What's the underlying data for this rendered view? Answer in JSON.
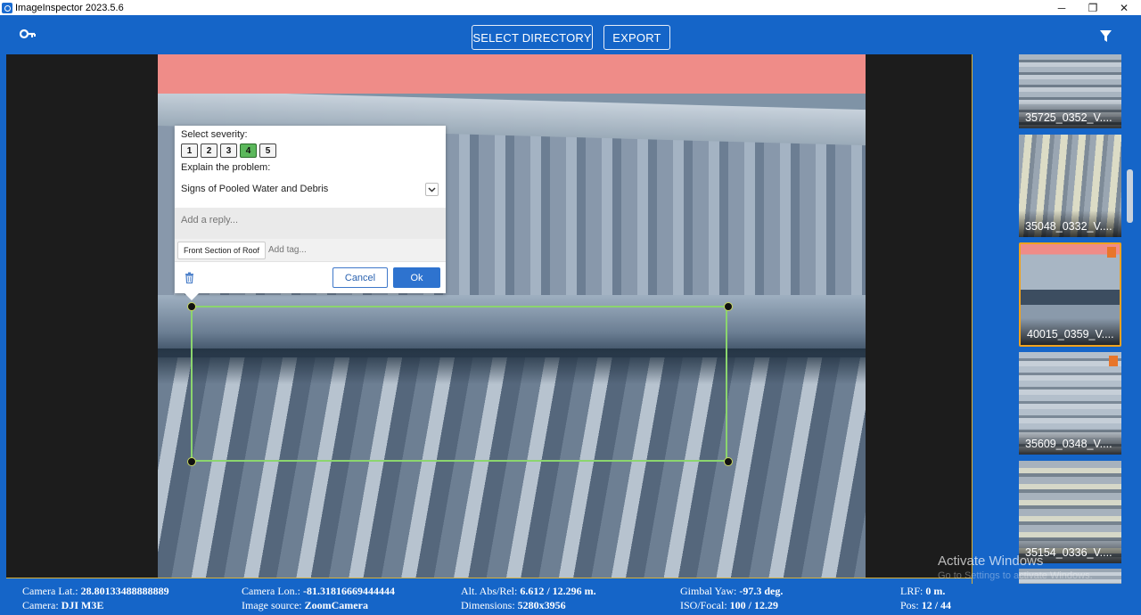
{
  "window": {
    "title": "ImageInspector 2023.5.6",
    "minimize_icon": "─",
    "restore_icon": "❐",
    "close_icon": "✕"
  },
  "toolbar": {
    "select_directory_label": "SELECT DIRECTORY",
    "export_label": "EXPORT",
    "accent_color": "#1565c8"
  },
  "annotation": {
    "severity_label": "Select severity:",
    "severity_options": [
      "1",
      "2",
      "3",
      "4",
      "5"
    ],
    "selected_severity": "4",
    "explain_label": "Explain the problem:",
    "problem_value": "Signs of Pooled Water and Debris",
    "reply_placeholder": "Add a reply...",
    "tags": [
      "Front Section of Roof"
    ],
    "tag_placeholder": "Add tag...",
    "cancel_label": "Cancel",
    "ok_label": "Ok"
  },
  "thumbnails": [
    {
      "caption": "35725_0352_V....",
      "selected": false,
      "flagged": false
    },
    {
      "caption": "35048_0332_V....",
      "selected": false,
      "flagged": false
    },
    {
      "caption": "40015_0359_V....",
      "selected": true,
      "flagged": true
    },
    {
      "caption": "35609_0348_V....",
      "selected": false,
      "flagged": true
    },
    {
      "caption": "35154_0336_V....",
      "selected": false,
      "flagged": false
    }
  ],
  "status": {
    "camera_lat_label": "Camera Lat.:",
    "camera_lat": "28.80133488888889",
    "camera_label": "Camera:",
    "camera": "DJI M3E",
    "camera_lon_label": "Camera Lon.:",
    "camera_lon": "-81.31816669444444",
    "image_source_label": "Image source:",
    "image_source": "ZoomCamera",
    "alt_label": "Alt. Abs/Rel:",
    "alt": "6.612 / 12.296 m.",
    "dimensions_label": "Dimensions:",
    "dimensions": "5280x3956",
    "gimbal_label": "Gimbal Yaw:",
    "gimbal": "-97.3 deg.",
    "iso_label": "ISO/Focal:",
    "iso": "100 / 12.29",
    "lrf_label": "LRF:",
    "lrf": "0 m.",
    "pos_label": "Pos:",
    "pos": "12 / 44"
  },
  "watermark": {
    "line1": "Activate Windows",
    "line2": "Go to Settings to activate Windows."
  }
}
